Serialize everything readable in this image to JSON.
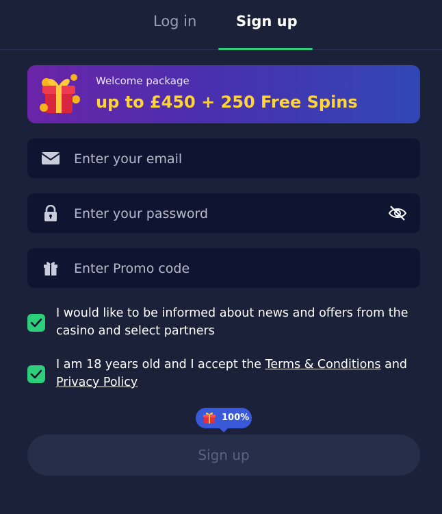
{
  "tabs": {
    "login": "Log in",
    "signup": "Sign up",
    "active": "signup"
  },
  "banner": {
    "small": "Welcome package",
    "big": "up to £450 + 250 Free Spins"
  },
  "fields": {
    "email": {
      "placeholder": "Enter your email",
      "icon": "envelope-icon"
    },
    "password": {
      "placeholder": "Enter your password",
      "icon": "lock-icon",
      "toggle_icon": "eye-slash-icon"
    },
    "promo": {
      "placeholder": "Enter Promo code",
      "icon": "gift-icon"
    }
  },
  "consents": {
    "news": {
      "checked": true,
      "text": "I would like to be informed about news and offers from the casino and select partners"
    },
    "terms": {
      "checked": true,
      "before": "I am 18 years old and I accept the ",
      "terms_link": "Terms & Conditions",
      "middle": " and ",
      "privacy_link": "Privacy Policy"
    }
  },
  "progress": {
    "label": "100%",
    "value": 100
  },
  "submit_label": "Sign up",
  "colors": {
    "background": "#1b2139",
    "field": "#0f1430",
    "accent": "#2ecf7a",
    "highlight": "#ffd43b",
    "badge": "#3a59d8"
  }
}
